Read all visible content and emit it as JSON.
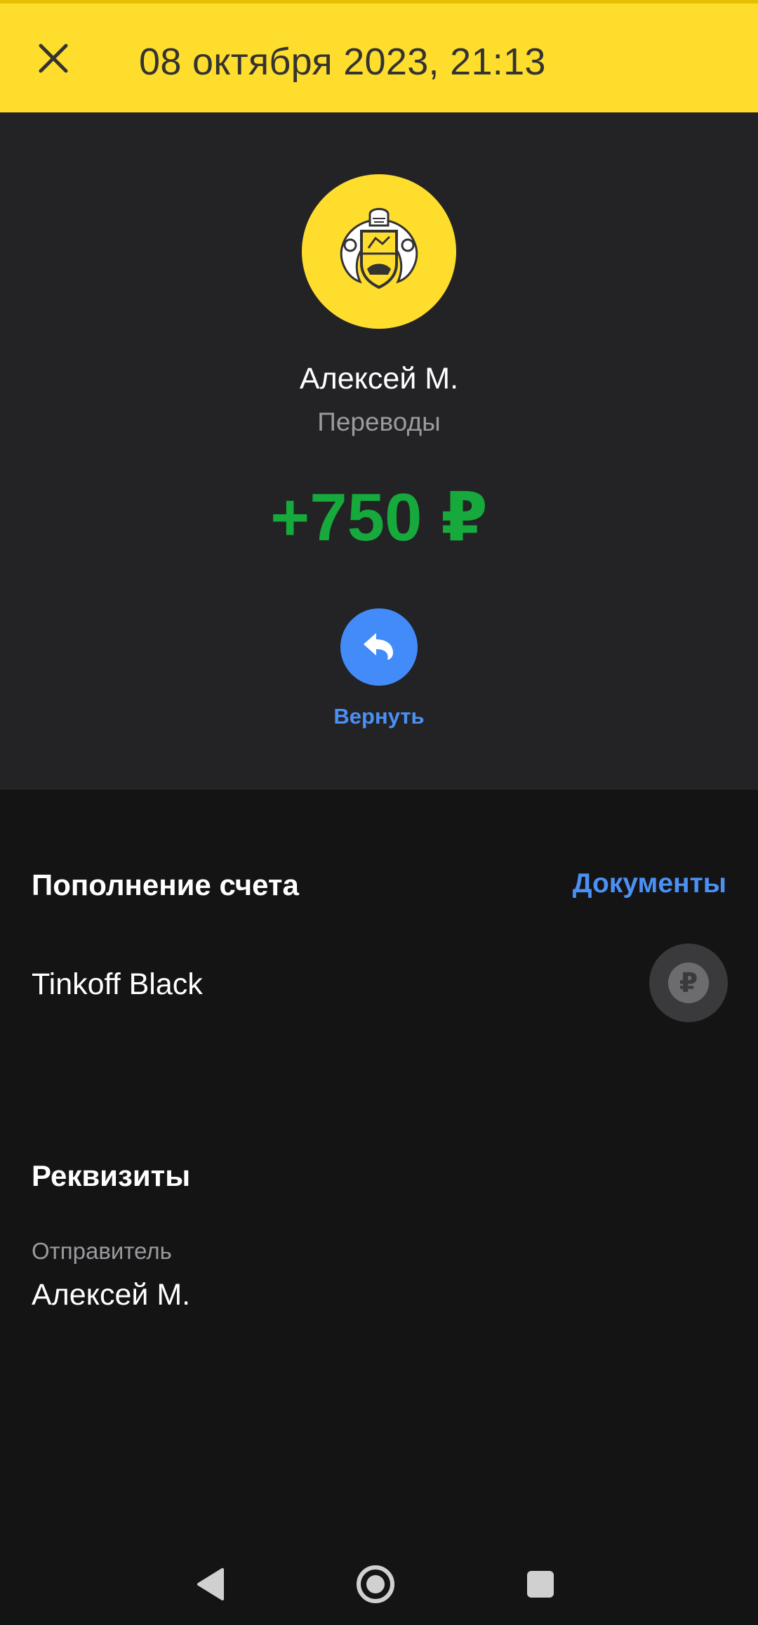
{
  "header": {
    "title": "08 октября 2023, 21:13",
    "close_icon": "close-icon"
  },
  "operation": {
    "logo_icon": "bank-emblem-icon",
    "counterparty": "Алексей М.",
    "category": "Переводы",
    "amount": "+750 ₽",
    "return_label": "Вернуть",
    "return_icon": "return-arrow-icon"
  },
  "account_section": {
    "title": "Пополнение счета",
    "documents_link": "Документы",
    "account_name": "Tinkoff Black",
    "account_icon": "ruble-icon",
    "account_icon_glyph": "₽"
  },
  "requisites": {
    "title": "Реквизиты",
    "sender_label": "Отправитель",
    "sender_value": "Алексей М."
  },
  "navbar": {
    "back_icon": "nav-back-icon",
    "home_icon": "nav-home-icon",
    "recents_icon": "nav-recents-icon"
  },
  "colors": {
    "accent_yellow": "#ffdd2d",
    "amount_green": "#16a93b",
    "link_blue": "#4a90f5",
    "background": "#141414",
    "hero_background": "#232326"
  }
}
